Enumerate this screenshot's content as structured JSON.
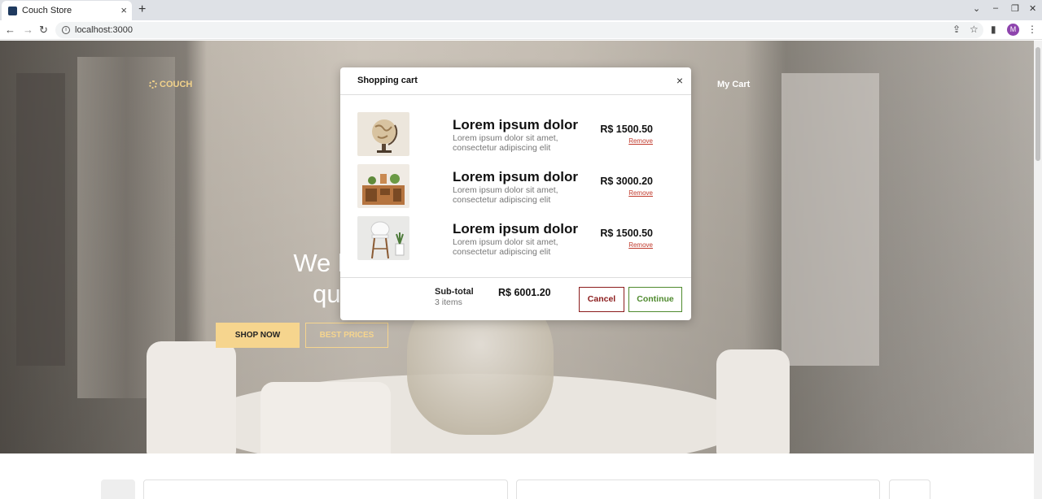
{
  "browser": {
    "tab_title": "Couch Store",
    "new_tab": "+",
    "url": "localhost:3000",
    "profile_initial": "M"
  },
  "site": {
    "logo_text": "COUCH",
    "cart_link": "My Cart",
    "hero_title_line1": "We have the b",
    "hero_title_line2": "quality furn",
    "shop_button": "SHOP NOW",
    "best_prices_button": "BEST PRICES"
  },
  "cart": {
    "title": "Shopping cart",
    "close": "×",
    "items": [
      {
        "name": "Lorem ipsum dolor",
        "description": "Lorem ipsum dolor sit amet, consectetur adipiscing elit",
        "price": "R$ 1500.50",
        "remove": "Remove",
        "thumb": "globe"
      },
      {
        "name": "Lorem ipsum dolor",
        "description": "Lorem ipsum dolor sit amet, consectetur adipiscing elit",
        "price": "R$ 3000.20",
        "remove": "Remove",
        "thumb": "shelves"
      },
      {
        "name": "Lorem ipsum dolor",
        "description": "Lorem ipsum dolor sit amet, consectetur adipiscing elit",
        "price": "R$ 1500.50",
        "remove": "Remove",
        "thumb": "chair"
      }
    ],
    "subtotal_label": "Sub-total",
    "items_count": "3 items",
    "subtotal_value": "R$ 6001.20",
    "cancel": "Cancel",
    "continue": "Continue"
  },
  "colors": {
    "accent": "#f6d58e",
    "cancel": "#8b1c1c",
    "continue": "#4f8a2e",
    "remove": "#c0392b"
  }
}
